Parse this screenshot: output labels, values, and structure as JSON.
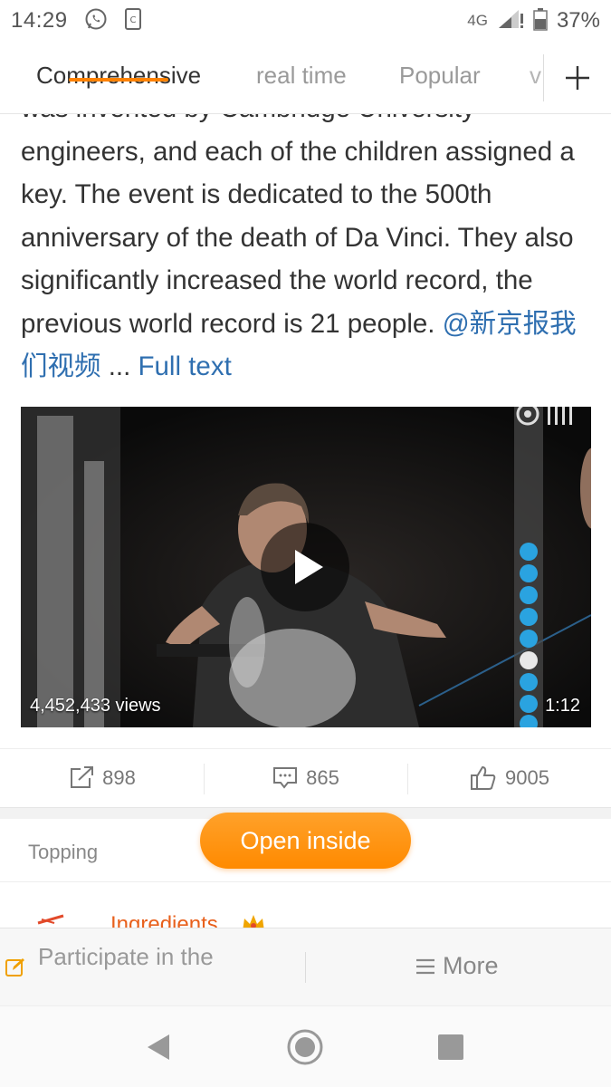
{
  "status_bar": {
    "time": "14:29",
    "network": "4G",
    "battery": "37%",
    "icons": [
      "whatsapp-icon",
      "cast-icon",
      "signal-icon",
      "battery-icon"
    ]
  },
  "tabs": {
    "items": [
      "Comprehensive",
      "real time",
      "Popular",
      "v"
    ],
    "active": "Comprehensive",
    "accent_color": "#ff8200"
  },
  "article": {
    "clipped_line": "was invented by Cambridge University",
    "body": "engineers, and each of the children assigned a key. The event is dedicated to the 500th anniversary of the death of Da Vinci. They also significantly increased the world record, the previous world record is 21 people. ",
    "mention": "@新京报我们视频",
    "ellipsis": " ... ",
    "full_text_link": "Full text"
  },
  "video": {
    "views": "4,452,433 views",
    "duration": "1:12"
  },
  "actions": {
    "repost": "898",
    "comment": "865",
    "like": "9005"
  },
  "topping": {
    "label": "Topping",
    "open_inside": "Open inside"
  },
  "comment_peek": {
    "name": "Ingredients"
  },
  "compose": {
    "placeholder": "Participate in the discussion",
    "more": "More"
  },
  "colors": {
    "link": "#2f6fb0",
    "orange": "#ff8a00"
  }
}
